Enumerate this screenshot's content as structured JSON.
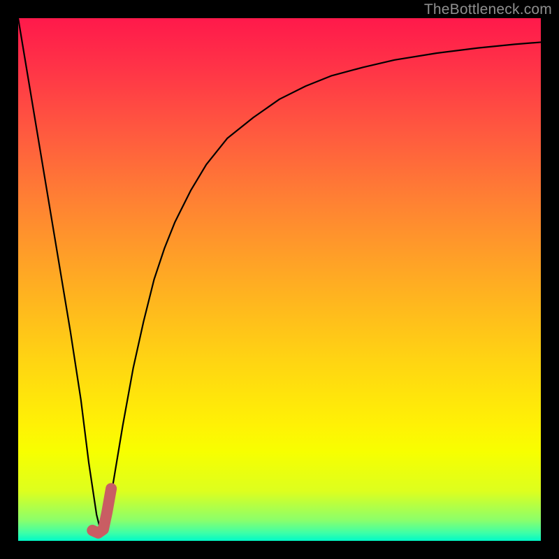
{
  "watermark": "TheBottleneck.com",
  "colors": {
    "frame": "#000000",
    "watermark": "#8f8f8f",
    "curve": "#000000",
    "marker": "#c95d63",
    "gradient_stops": [
      {
        "offset": 0.0,
        "color": "#ff144b"
      },
      {
        "offset": 0.0,
        "color": "#ff194b"
      },
      {
        "offset": 0.1,
        "color": "#ff3547"
      },
      {
        "offset": 0.22,
        "color": "#ff5a3f"
      },
      {
        "offset": 0.35,
        "color": "#ff8133"
      },
      {
        "offset": 0.5,
        "color": "#ffab23"
      },
      {
        "offset": 0.65,
        "color": "#ffd313"
      },
      {
        "offset": 0.78,
        "color": "#fff205"
      },
      {
        "offset": 0.83,
        "color": "#f7ff00"
      },
      {
        "offset": 0.905,
        "color": "#ddff1e"
      },
      {
        "offset": 0.96,
        "color": "#8cff6a"
      },
      {
        "offset": 0.985,
        "color": "#3dffa8"
      },
      {
        "offset": 1.0,
        "color": "#00f9c8"
      }
    ]
  },
  "chart_data": {
    "type": "line",
    "title": "",
    "xlabel": "",
    "ylabel": "",
    "xlim": [
      0,
      100
    ],
    "ylim": [
      0,
      100
    ],
    "series": [
      {
        "name": "bottleneck-curve",
        "x": [
          0,
          2,
          4,
          6,
          8,
          10,
          12,
          13.5,
          15,
          16,
          17,
          18,
          20,
          22,
          24,
          26,
          28,
          30,
          33,
          36,
          40,
          45,
          50,
          55,
          60,
          66,
          72,
          80,
          88,
          95,
          100
        ],
        "y": [
          100,
          88,
          76,
          64,
          52,
          40,
          27,
          15,
          5,
          1,
          4,
          10,
          22,
          33,
          42,
          50,
          56,
          61,
          67,
          72,
          77,
          81,
          84.5,
          87,
          89,
          90.6,
          92,
          93.3,
          94.3,
          95,
          95.4
        ]
      }
    ],
    "marker": {
      "name": "sweet-spot-marker",
      "points": [
        {
          "x": 14.2,
          "y": 2.0
        },
        {
          "x": 15.3,
          "y": 1.5
        },
        {
          "x": 16.3,
          "y": 2.2
        },
        {
          "x": 17.0,
          "y": 5.5
        },
        {
          "x": 17.8,
          "y": 10.0
        }
      ]
    }
  }
}
